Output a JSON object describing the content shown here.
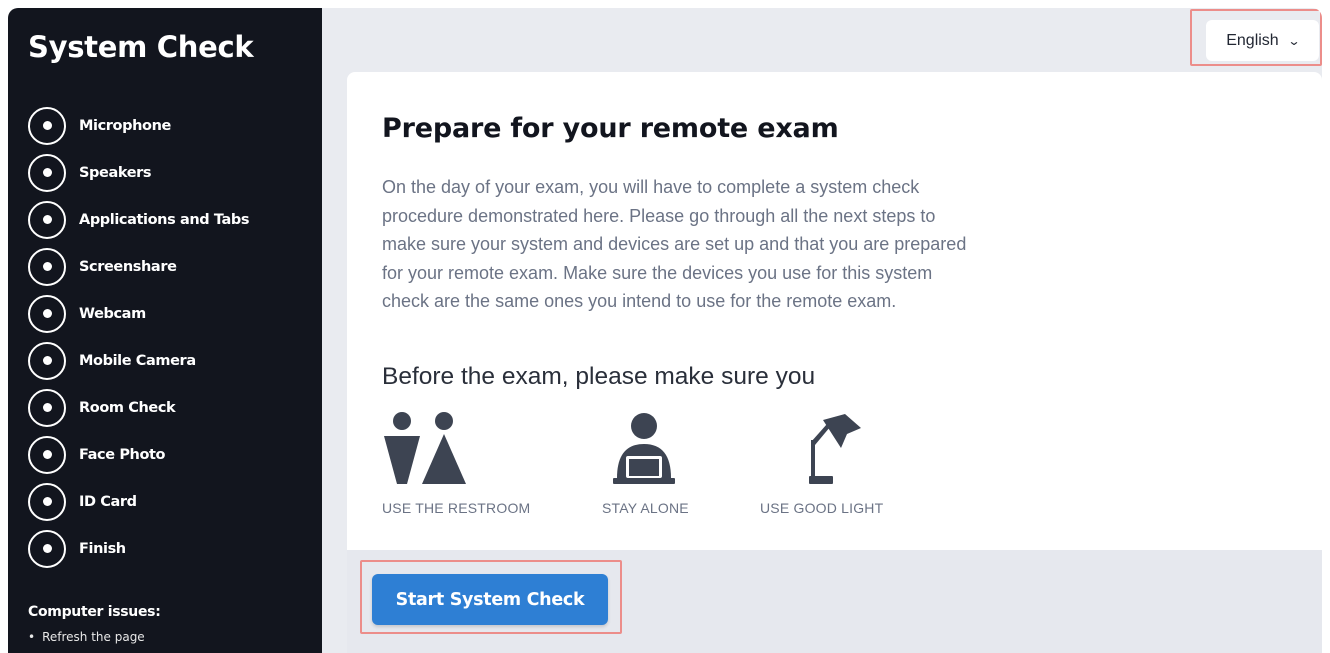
{
  "sidebar": {
    "title": "System Check",
    "steps": [
      {
        "label": "Microphone"
      },
      {
        "label": "Speakers"
      },
      {
        "label": "Applications and Tabs"
      },
      {
        "label": "Screenshare"
      },
      {
        "label": "Webcam"
      },
      {
        "label": "Mobile Camera"
      },
      {
        "label": "Room Check"
      },
      {
        "label": "Face Photo"
      },
      {
        "label": "ID Card"
      },
      {
        "label": "Finish"
      }
    ],
    "issues_title": "Computer issues:",
    "issues": [
      "Refresh the page"
    ]
  },
  "header": {
    "language": "English"
  },
  "main": {
    "title": "Prepare for your remote exam",
    "intro": "On the day of your exam, you will have to complete a system check procedure demonstrated here. Please go through all the next steps to make sure your system and devices are set up and that you are prepared for your remote exam. Make sure the devices you use for this system check are the same ones you intend to use for the remote exam.",
    "subtitle": "Before the exam, please make sure you",
    "tips": [
      {
        "icon": "restroom-icon",
        "label": "USE THE RESTROOM"
      },
      {
        "icon": "person-alone-icon",
        "label": "STAY ALONE"
      },
      {
        "icon": "desk-lamp-icon",
        "label": "USE GOOD LIGHT"
      }
    ]
  },
  "footer": {
    "start_label": "Start System Check"
  },
  "colors": {
    "sidebar_bg": "#12151e",
    "page_bg": "#e9ebf0",
    "accent": "#2e7fd4",
    "highlight_border": "#ec8d8a",
    "icon": "#3d4452"
  }
}
